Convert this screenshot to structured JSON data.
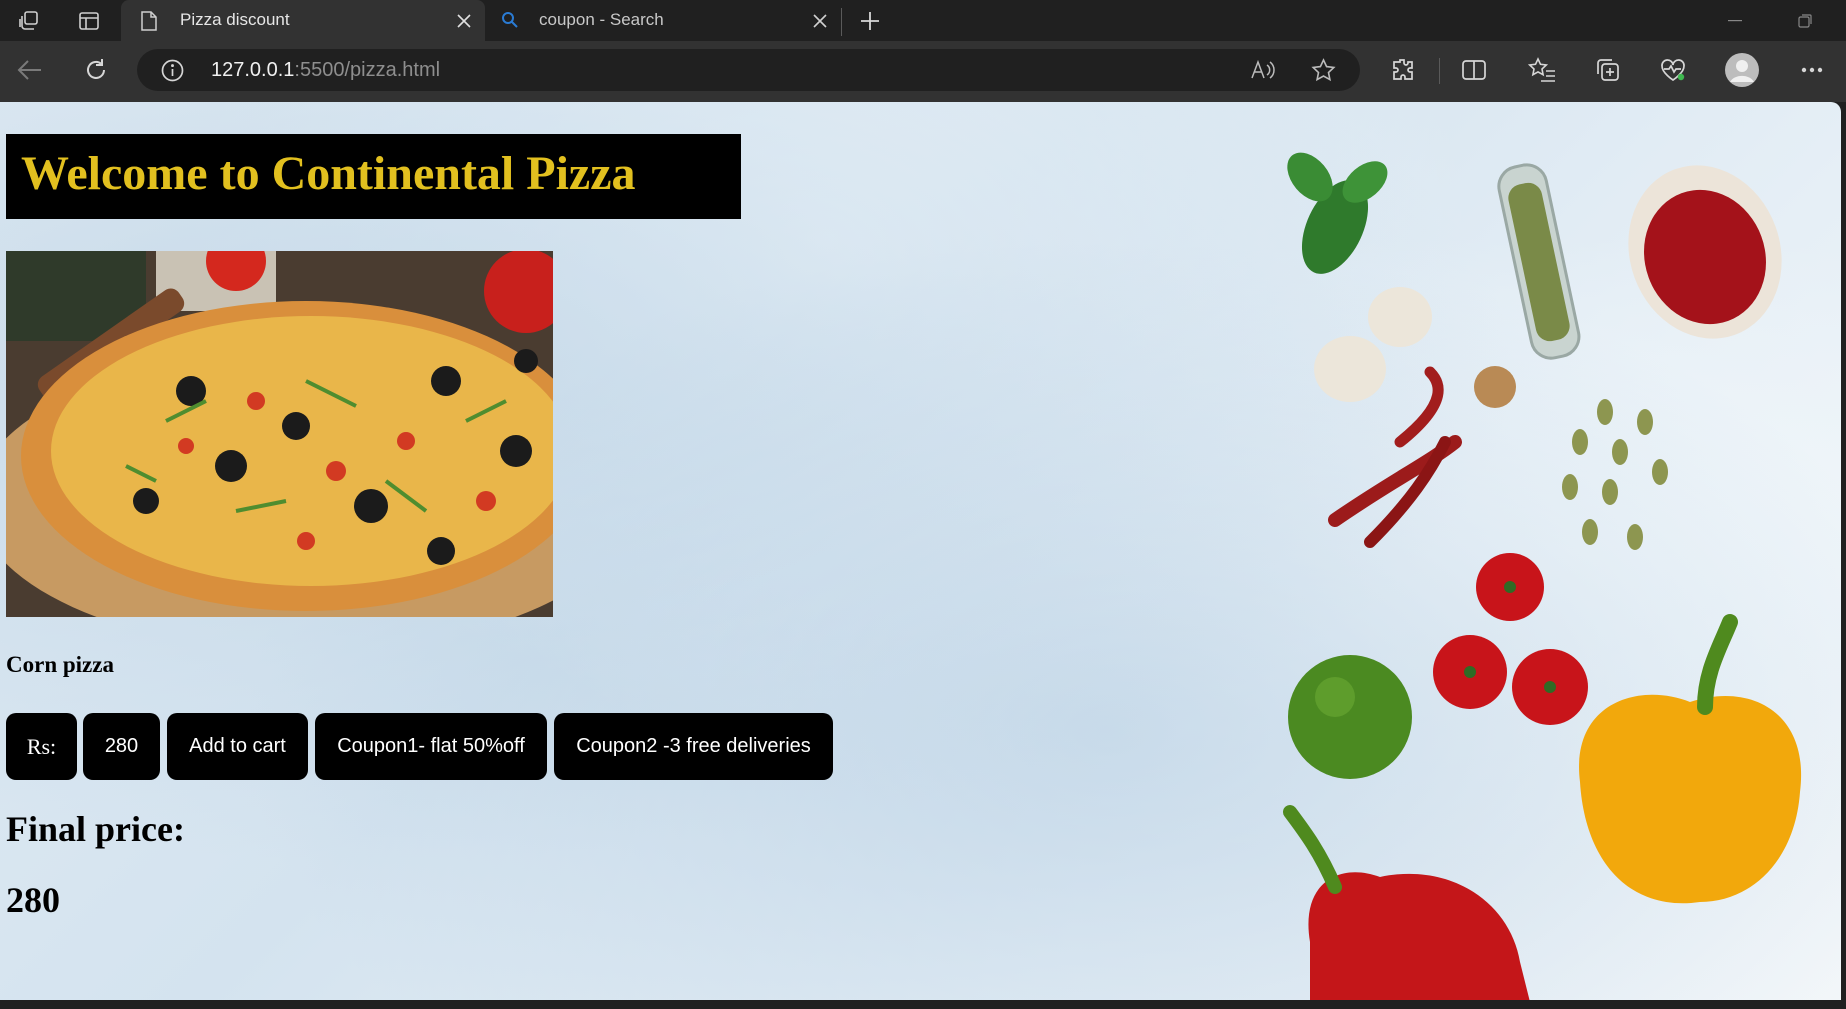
{
  "browser": {
    "tabs": [
      {
        "title": "Pizza discount",
        "active": true,
        "icon": "page-icon"
      },
      {
        "title": "coupon - Search",
        "active": false,
        "icon": "search-icon"
      }
    ],
    "address": {
      "host": "127.0.0.1",
      "path": ":5500/pizza.html"
    }
  },
  "page": {
    "heading": "Welcome to Continental Pizza",
    "heading_color": "#e2c01f",
    "item_name": "Corn pizza",
    "price_label": "Rs:",
    "price_value": "280",
    "buttons": {
      "add_to_cart": "Add to cart",
      "coupon1": "Coupon1- flat 50%off",
      "coupon2": "Coupon2 -3 free deliveries"
    },
    "final_price_label": "Final price:",
    "final_price_value": "280"
  }
}
